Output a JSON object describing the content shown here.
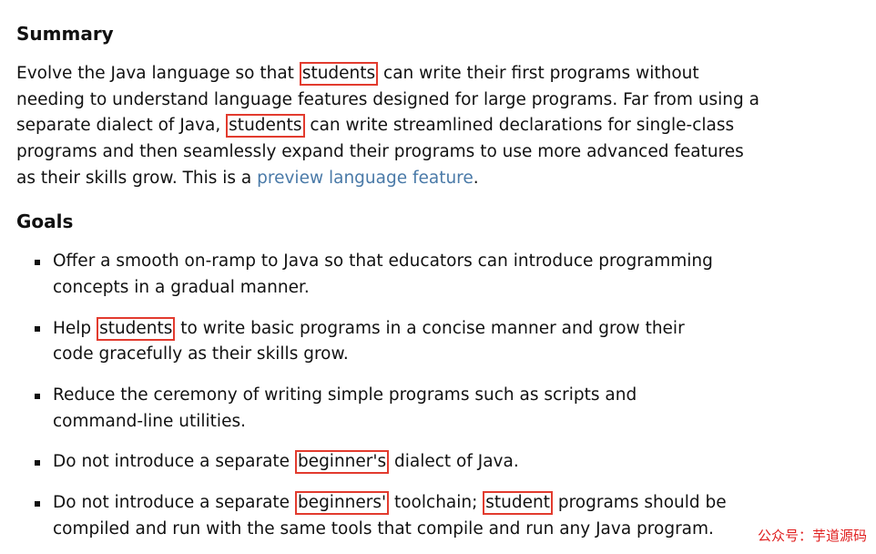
{
  "headings": {
    "summary": "Summary",
    "goals": "Goals"
  },
  "summary": {
    "t1": "Evolve the Java language so that ",
    "h1": "students",
    "t2": " can write their first programs without needing to understand language features designed for large programs. Far from using a separate dialect of Java, ",
    "h2": "students",
    "t3": " can write streamlined declarations for single-class programs and then seamlessly expand their programs to use more advanced features as their skills grow. This is a ",
    "link": "preview language feature",
    "t4": "."
  },
  "goals": {
    "g1": "Offer a smooth on-ramp to Java so that educators can introduce programming concepts in a gradual manner.",
    "g2": {
      "t1": "Help ",
      "h1": "students",
      "t2": " to write basic programs in a concise manner and grow their code gracefully as their skills grow."
    },
    "g3": "Reduce the ceremony of writing simple programs such as scripts and command-line utilities.",
    "g4": {
      "t1": "Do not introduce a separate ",
      "h1": "beginner's",
      "t2": " dialect of Java."
    },
    "g5": {
      "t1": "Do not introduce a separate ",
      "h1": "beginners'",
      "t2": " toolchain; ",
      "h2": "student",
      "t3": " programs should be compiled and run with the same tools that compile and run any Java program."
    }
  },
  "watermark": "公众号：芋道源码"
}
